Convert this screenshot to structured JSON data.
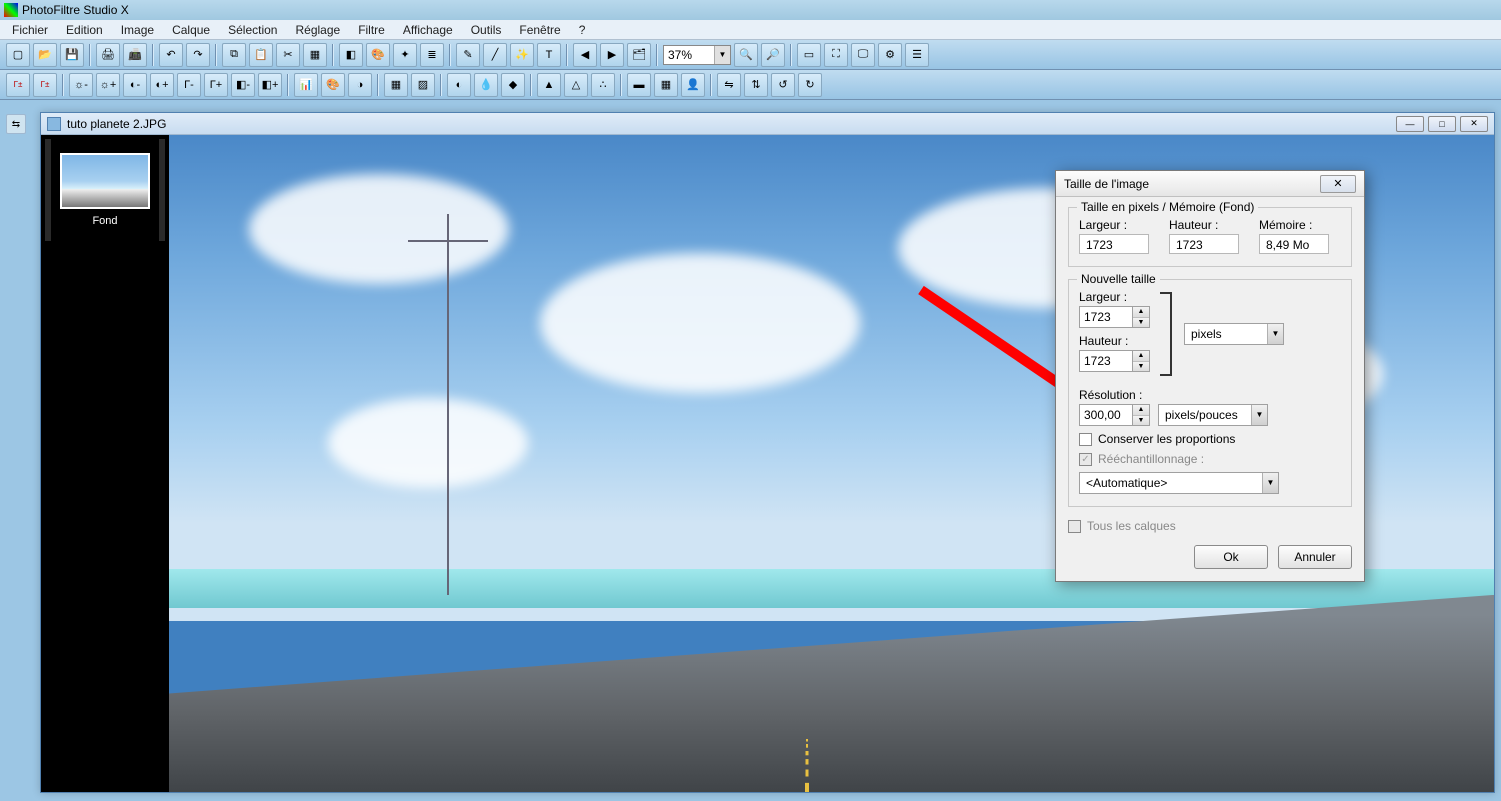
{
  "app": {
    "title": "PhotoFiltre Studio X"
  },
  "menus": [
    "Fichier",
    "Edition",
    "Image",
    "Calque",
    "Sélection",
    "Réglage",
    "Filtre",
    "Affichage",
    "Outils",
    "Fenêtre",
    "?"
  ],
  "zoom": {
    "value": "37%"
  },
  "document": {
    "title": "tuto planete 2.JPG",
    "layer_label": "Fond"
  },
  "dialog": {
    "title": "Taille de l'image",
    "section1_legend": "Taille en pixels / Mémoire (Fond)",
    "width_label": "Largeur :",
    "height_label": "Hauteur :",
    "memory_label": "Mémoire :",
    "cur_width": "1723",
    "cur_height": "1723",
    "memory": "8,49 Mo",
    "section2_legend": "Nouvelle taille",
    "new_width": "1723",
    "new_height": "1723",
    "unit_size": "pixels",
    "resolution_label": "Résolution :",
    "resolution": "300,00",
    "unit_res": "pixels/pouces",
    "keep_prop": "Conserver les proportions",
    "resample": "Rééchantillonnage :",
    "resample_mode": "<Automatique>",
    "all_layers": "Tous les calques",
    "ok": "Ok",
    "cancel": "Annuler"
  }
}
